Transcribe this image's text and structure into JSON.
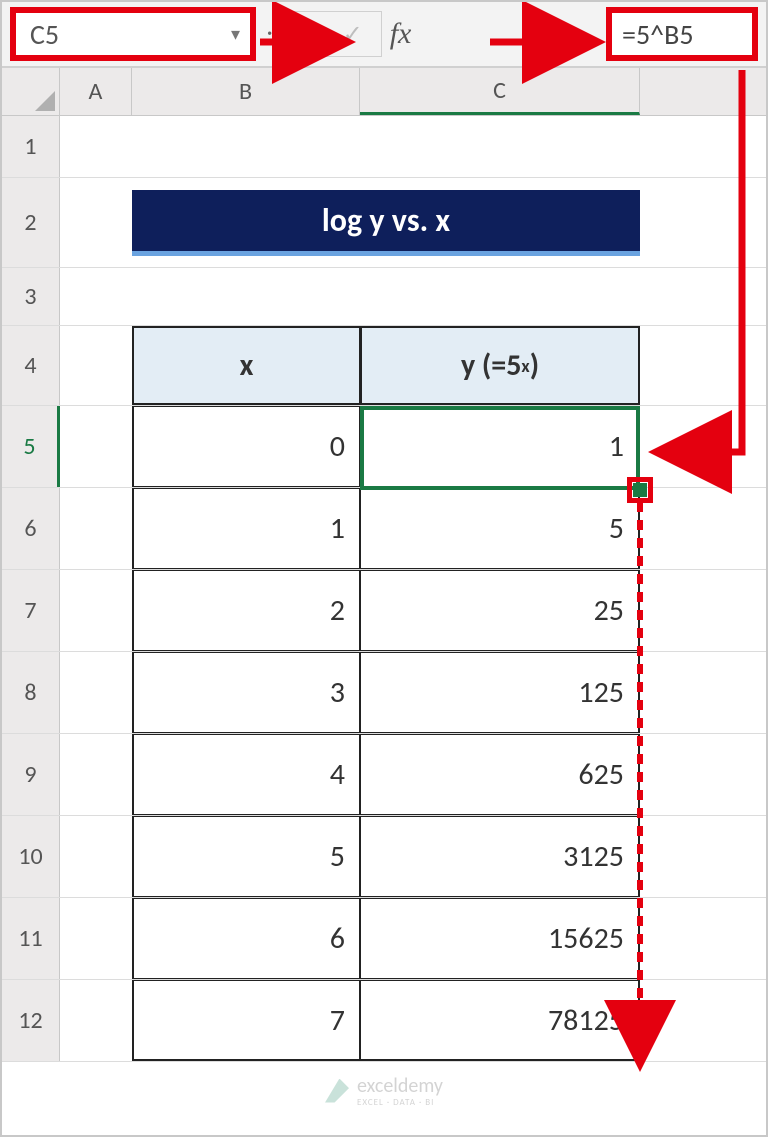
{
  "formula_bar": {
    "name_box": "C5",
    "formula": "=5^B5"
  },
  "columns": {
    "A": "A",
    "B": "B",
    "C": "C"
  },
  "rows": [
    "1",
    "2",
    "3",
    "4",
    "5",
    "6",
    "7",
    "8",
    "9",
    "10",
    "11",
    "12"
  ],
  "title": "log y vs. x",
  "headers": {
    "x": "x",
    "y_prefix": "y (=5",
    "y_sup": "x",
    "y_suffix": ")"
  },
  "data": [
    {
      "x": "0",
      "y": "1"
    },
    {
      "x": "1",
      "y": "5"
    },
    {
      "x": "2",
      "y": "25"
    },
    {
      "x": "3",
      "y": "125"
    },
    {
      "x": "4",
      "y": "625"
    },
    {
      "x": "5",
      "y": "3125"
    },
    {
      "x": "6",
      "y": "15625"
    },
    {
      "x": "7",
      "y": "78125"
    }
  ],
  "watermark": {
    "brand": "exceldemy",
    "tag": "EXCEL · DATA · BI"
  },
  "chart_data": {
    "type": "table",
    "title": "log y vs. x",
    "columns": [
      "x",
      "y (=5^x)"
    ],
    "rows": [
      [
        0,
        1
      ],
      [
        1,
        5
      ],
      [
        2,
        25
      ],
      [
        3,
        125
      ],
      [
        4,
        625
      ],
      [
        5,
        3125
      ],
      [
        6,
        15625
      ],
      [
        7,
        78125
      ]
    ],
    "formula": "=5^B5",
    "active_cell": "C5"
  }
}
